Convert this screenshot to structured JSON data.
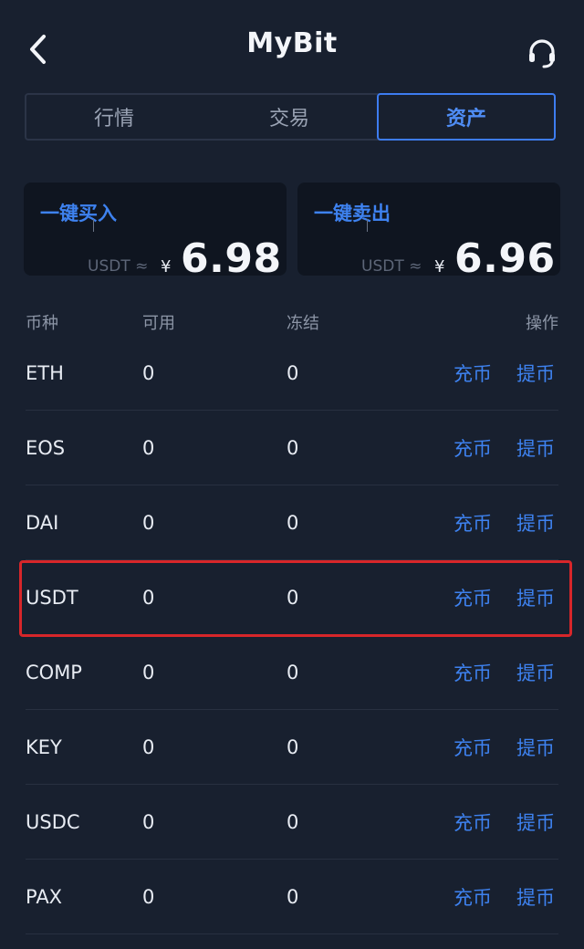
{
  "header": {
    "title": "MyBit",
    "back_icon": "chevron-left-icon",
    "support_icon": "headset-icon"
  },
  "tabs": [
    {
      "label": "行情",
      "active": false
    },
    {
      "label": "交易",
      "active": false
    },
    {
      "label": "资产",
      "active": true
    }
  ],
  "quick": {
    "buy": {
      "title": "一键买入",
      "unit": "USDT ≈",
      "currency": "¥",
      "price": "6.98"
    },
    "sell": {
      "title": "一键卖出",
      "unit": "USDT ≈",
      "currency": "¥",
      "price": "6.96"
    }
  },
  "table": {
    "headers": {
      "coin": "币种",
      "available": "可用",
      "frozen": "冻结",
      "actions": "操作"
    },
    "deposit_label": "充币",
    "withdraw_label": "提币",
    "rows": [
      {
        "coin": "ETH",
        "available": "0",
        "frozen": "0"
      },
      {
        "coin": "EOS",
        "available": "0",
        "frozen": "0"
      },
      {
        "coin": "DAI",
        "available": "0",
        "frozen": "0"
      },
      {
        "coin": "USDT",
        "available": "0",
        "frozen": "0",
        "highlighted": true
      },
      {
        "coin": "COMP",
        "available": "0",
        "frozen": "0"
      },
      {
        "coin": "KEY",
        "available": "0",
        "frozen": "0"
      },
      {
        "coin": "USDC",
        "available": "0",
        "frozen": "0"
      },
      {
        "coin": "PAX",
        "available": "0",
        "frozen": "0"
      }
    ]
  },
  "colors": {
    "background": "#18202f",
    "accent": "#3e82f0",
    "highlight_border": "#d7262a"
  }
}
